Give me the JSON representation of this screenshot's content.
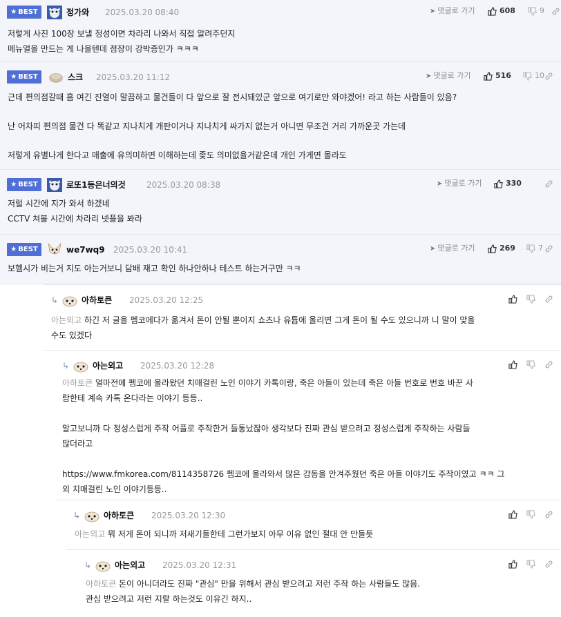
{
  "best_label": "BEST",
  "reply_label": "댓글로 가기",
  "comments": [
    {
      "nick": "정가와",
      "date": "2025.03.20 08:40",
      "likes": "608",
      "dislikes": "9",
      "lines": [
        "저렇게 사진 100장 보낼 정성이면 차라리 나와서 직접 알려주던지",
        "메뉴얼을 만드는 게 나을텐데 점장이 강박증인가 ㅋㅋㅋ"
      ]
    },
    {
      "nick": "스크",
      "date": "2025.03.20 11:12",
      "likes": "516",
      "dislikes": "10",
      "lines": [
        "근데 편의점갈때 흠 여긴 진열이 말끔하고 물건들이 다 앞으로 잘 전시돼있군 앞으로 여기로만 와야겠어! 라고 하는 사람들이 있음?",
        "",
        "난 어차피 편의점 물건 다 똑같고 지나치게 개판이거나 지나치게 싸가지 없는거 아니면 무조건 거리 가까운곳 가는데",
        "",
        "저렇게 유별나게 한다고 매출에 유의미하면 이해하는데 좆도 의미없을거같은데 개인 가게면 몰라도"
      ]
    },
    {
      "nick": "로또1등은너의것",
      "date": "2025.03.20 08:38",
      "likes": "330",
      "lines": [
        "저럴 시간에 지가 와서 하겠네",
        "CCTV 쳐볼 시간에 차라리 넷플을 봐라"
      ]
    },
    {
      "nick": "we7wq9",
      "date": "2025.03.20 10:41",
      "likes": "269",
      "dislikes": "7",
      "lines": [
        "보헴시가 비는거 지도 아는거보니 담배 재고 확인 하나안하나 테스트 하는거구만 ㅋㅋ"
      ]
    }
  ],
  "replies": [
    {
      "nick": "아하토큰",
      "date": "2025.03.20 12:25",
      "target": "아는외고",
      "lines": [
        "하긴 저 글을 펨코에다가 옮겨서 돈이 안될 뿐이지 쇼츠나 유튭에 올리면 그게 돈이 될 수도 있으니까 니 말이 맞을",
        "수도 있겠다"
      ]
    },
    {
      "nick": "아는외고",
      "date": "2025.03.20 12:28",
      "target": "아하토큰",
      "lines": [
        "얼마전에 펨코에 올라왔던 치매걸린 노인 이야기 카톡이랑, 죽은 아들이 있는데 죽은 아들 번호로 번호 바꾼 사",
        "람한테 계속 카톡 온다라는 이야기 등등..",
        "",
        "알고보니까 다 정성스럽게 주작 어플로 주작한거 들통났잖아 생각보다 진짜 관심 받으려고 정성스럽게 주작하는 사람들",
        "많더라고",
        "",
        "https://www.fmkorea.com/8114358726 펨코에 올라와서 많은 감동을 안겨주웠던 죽은 아들 이야기도 주작이였고 ㅋㅋ 그",
        "외 치매걸린 노인 이야기등등.."
      ]
    },
    {
      "nick": "아하토큰",
      "date": "2025.03.20 12:30",
      "target": "아는외고",
      "lines": [
        "뭐 저게 돈이 되니까 저새기들한테 그런가보지 아무 이유 없인 절대 안 만들듯"
      ]
    },
    {
      "nick": "아는외고",
      "date": "2025.03.20 12:31",
      "target": "아하토큰",
      "lines": [
        "돈이 아니더라도 진짜 \"관심\" 만을 위해서 관심 받으려고 저런 주작 하는 사람들도 많음.",
        "관심 받으려고 저런 지랄 하는것도 이유긴 하지.."
      ]
    }
  ]
}
